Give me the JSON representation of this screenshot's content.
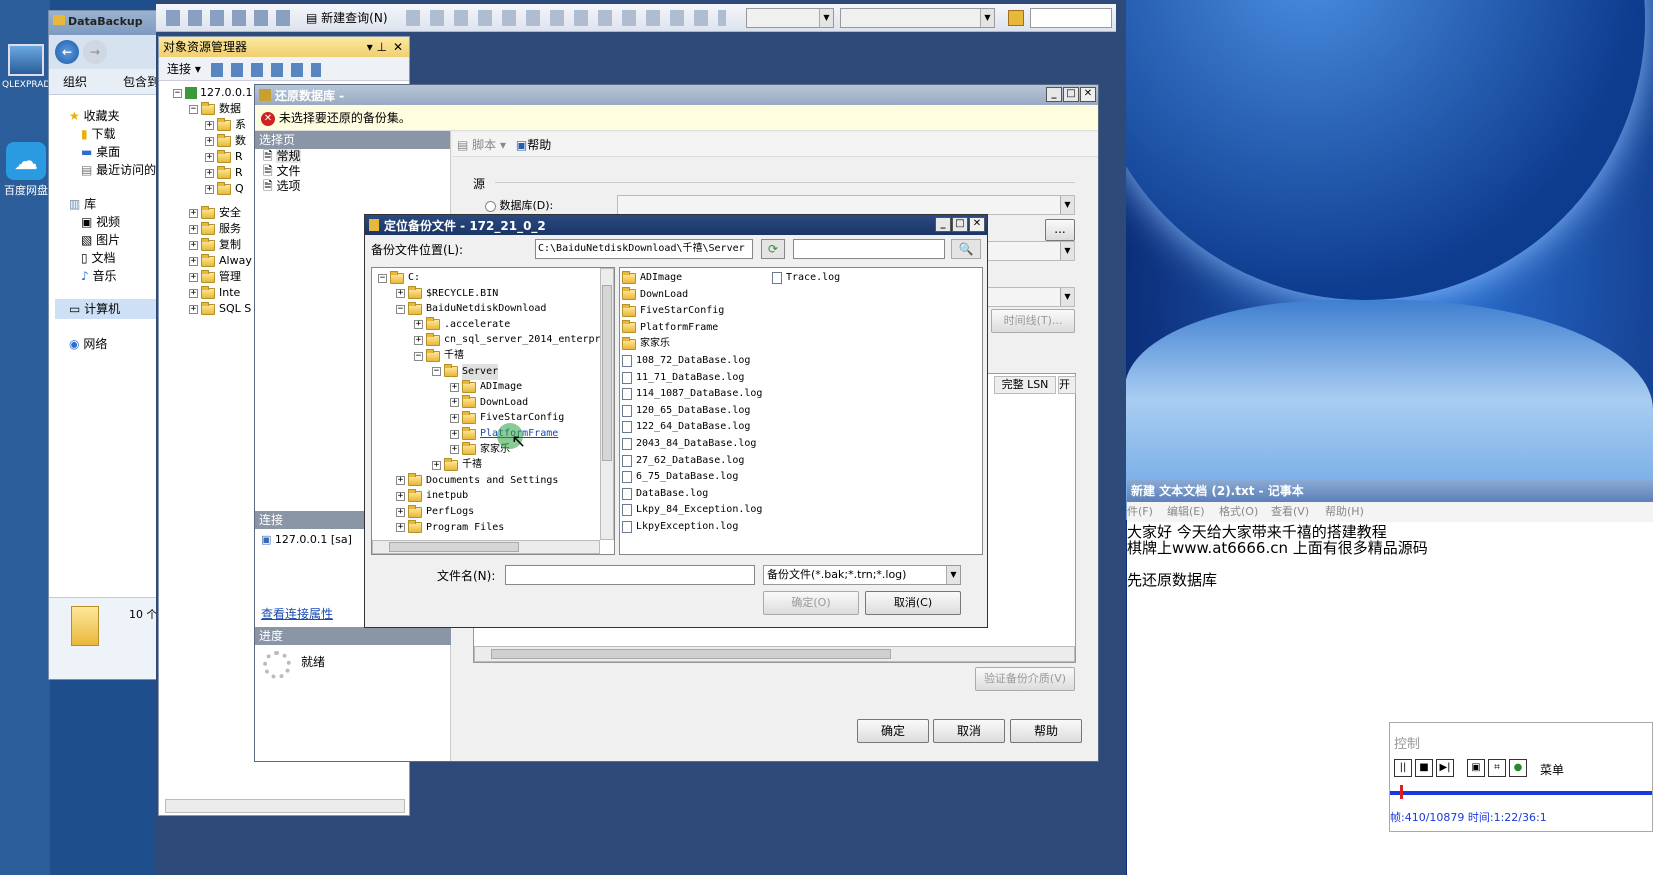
{
  "explorer": {
    "title": "DataBackup",
    "organize": "组织",
    "include": "包含到",
    "favorites": "收藏夹",
    "downloads": "下载",
    "desktop": "桌面",
    "recent": "最近访问的",
    "libraries": "库",
    "videos": "视频",
    "pictures": "图片",
    "documents": "文档",
    "music": "音乐",
    "computer": "计算机",
    "network": "网络",
    "count": "10 个"
  },
  "desktop": {
    "icon1": "QLEXPRAD",
    "icon2": "百度网盘"
  },
  "ssms": {
    "new_query": "新建查询(N)",
    "oe_title": "对象资源管理器",
    "connect": "连接",
    "root": "127.0.0.1",
    "nodes": [
      "数据",
      "系",
      "数",
      "R",
      "R",
      "Q",
      "安全",
      "服务",
      "复制",
      "Alway",
      "管理",
      "Inte",
      "SQL S"
    ]
  },
  "restore": {
    "title": "还原数据库 -",
    "error": "未选择要还原的备份集。",
    "select_page": "选择页",
    "pages": [
      "常规",
      "文件",
      "选项"
    ],
    "script": "脚本",
    "help": "帮助",
    "source": "源",
    "database_radio": "数据库(D):",
    "timeline": "时间线(T)...",
    "col_lsn": "完整 LSN",
    "col_start": "开",
    "connection": "连接",
    "conn_value": "127.0.0.1 [sa]",
    "view_conn": "查看连接属性",
    "progress": "进度",
    "ready": "就绪",
    "verify": "验证备份介质(V)",
    "ok": "确定",
    "cancel": "取消",
    "help_btn": "帮助",
    "browse": "..."
  },
  "locate": {
    "title": "定位备份文件 - 172_21_0_2",
    "location_label": "备份文件位置(L):",
    "location_value": "C:\\BaiduNetdiskDownload\\千禧\\Server",
    "tree": [
      {
        "label": "C:",
        "level": 0,
        "sign": "⊟"
      },
      {
        "label": "$RECYCLE.BIN",
        "level": 1,
        "sign": "⊞"
      },
      {
        "label": "BaiduNetdiskDownload",
        "level": 1,
        "sign": "⊟"
      },
      {
        "label": ".accelerate",
        "level": 2,
        "sign": "⊞"
      },
      {
        "label": "cn_sql_server_2014_enterpr",
        "level": 2,
        "sign": "⊞"
      },
      {
        "label": "千禧",
        "level": 2,
        "sign": "⊟"
      },
      {
        "label": "Server",
        "level": 3,
        "sign": "⊟"
      },
      {
        "label": "ADImage",
        "level": 4,
        "sign": "⊞"
      },
      {
        "label": "DownLoad",
        "level": 4,
        "sign": "⊞"
      },
      {
        "label": "FiveStarConfig",
        "level": 4,
        "sign": "⊞"
      },
      {
        "label": "PlatformFrame",
        "level": 4,
        "sign": "⊞"
      },
      {
        "label": "家家乐",
        "level": 4,
        "sign": "⊞"
      },
      {
        "label": "千禧",
        "level": 3,
        "sign": "⊞"
      },
      {
        "label": "Documents and Settings",
        "level": 1,
        "sign": "⊞"
      },
      {
        "label": "inetpub",
        "level": 1,
        "sign": "⊞"
      },
      {
        "label": "PerfLogs",
        "level": 1,
        "sign": "⊞"
      },
      {
        "label": "Program Files",
        "level": 1,
        "sign": "⊞"
      }
    ],
    "folders": [
      "ADImage",
      "DownLoad",
      "FiveStarConfig",
      "PlatformFrame",
      "家家乐"
    ],
    "files": [
      "108_72_DataBase.log",
      "11_71_DataBase.log",
      "114_1087_DataBase.log",
      "120_65_DataBase.log",
      "122_64_DataBase.log",
      "2043_84_DataBase.log",
      "27_62_DataBase.log",
      "6_75_DataBase.log",
      "DataBase.log",
      "Lkpy_84_Exception.log",
      "LkpyException.log"
    ],
    "file_col2": [
      "Trace.log"
    ],
    "filename_label": "文件名(N):",
    "filter": "备份文件(*.bak;*.trn;*.log)",
    "ok": "确定(O)",
    "cancel": "取消(C)"
  },
  "notepad": {
    "title": "新建 文本文档 (2).txt - 记事本",
    "menu": [
      "件(F)",
      "编辑(E)",
      "格式(O)",
      "查看(V)",
      "帮助(H)"
    ],
    "lines": [
      "大家好 今天给大家带来千禧的搭建教程",
      "棋牌上www.at6666.cn 上面有很多精品源码",
      "",
      "先还原数据库"
    ]
  },
  "control": {
    "title": "控制",
    "menu": "菜单",
    "status": "帧:410/10879 时间:1:22/36:1"
  }
}
